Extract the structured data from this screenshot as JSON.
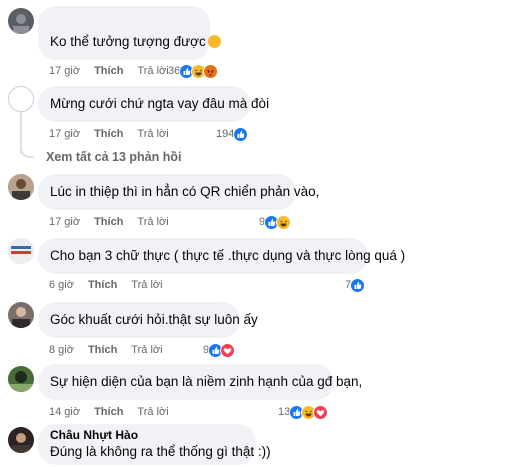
{
  "comments": [
    {
      "text": "Ko thể tưởng tượng được",
      "time": "17 giờ",
      "like": "Thích",
      "reply": "Trả lời",
      "reactions": "36",
      "icons": [
        "like-icon",
        "haha-icon",
        "angry-icon"
      ]
    },
    {
      "text": "Mừng cưới chứ ngta vay đâu mà đòi",
      "time": "17 giờ",
      "like": "Thích",
      "reply": "Trả lời",
      "reactions": "194",
      "icons": [
        "like-icon"
      ]
    },
    {
      "text": "Lúc in thiệp thì in hẳn có QR chiển phản vào,",
      "time": "17 giờ",
      "like": "Thích",
      "reply": "Trả lời",
      "reactions": "9",
      "icons": [
        "like-icon",
        "haha-icon"
      ]
    },
    {
      "text": "Cho bạn 3 chữ thực ( thực tế .thực dụng và thực lòng quá )",
      "time": "6 giờ",
      "like": "Thích",
      "reply": "Trả lời",
      "reactions": "7",
      "icons": [
        "like-icon"
      ]
    },
    {
      "text": "Góc khuất cưới hỏi.thật sự luôn ấy",
      "time": "8 giờ",
      "like": "Thích",
      "reply": "Trả lời",
      "reactions": "9",
      "icons": [
        "like-icon",
        "love-icon"
      ]
    },
    {
      "text": "Sự hiện diện của bạn là niềm zinh hạnh của gđ bạn,",
      "time": "14 giờ",
      "like": "Thích",
      "reply": "Trả lời",
      "reactions": "13",
      "icons": [
        "like-icon",
        "haha-icon",
        "love-icon"
      ]
    },
    {
      "author": "Châu Nhựt Hào",
      "text": "Đúng là không ra thể thống gì thật :))"
    }
  ],
  "view_replies": "Xem tất cả 13 phản hồi",
  "colors": {
    "like": "#1877f2",
    "haha": "#f7b928",
    "angry": "#e9710f",
    "love": "#f33e58",
    "bubble": "#f0f2f5",
    "meta": "#65676b"
  }
}
